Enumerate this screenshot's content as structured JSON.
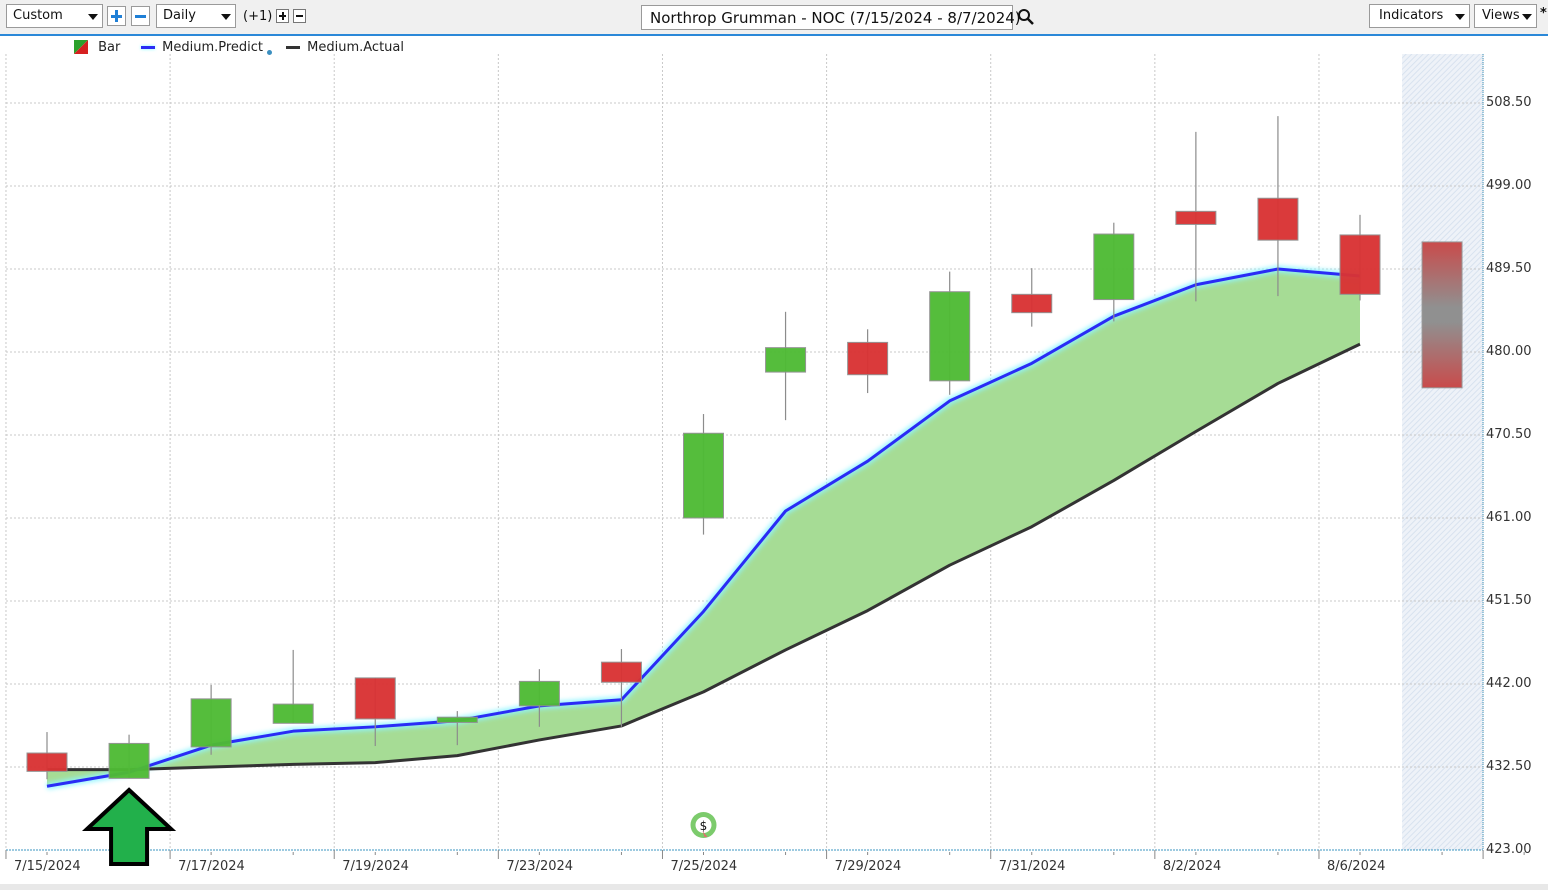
{
  "toolbar": {
    "range_select": "Custom",
    "zoom_in_label": "+",
    "zoom_out_label": "−",
    "interval_select": "Daily",
    "offset_label": "(+1)",
    "offset_plus": "+",
    "offset_minus": "−",
    "symbol_title": "Northrop Grumman - NOC (7/15/2024 - 8/7/2024)",
    "search_icon": "magnifier-icon",
    "indicators_label": "Indicators",
    "views_label": "Views",
    "modified_marker": "*"
  },
  "legend": [
    {
      "label": "Bar",
      "icon": "bar-up-down-icon"
    },
    {
      "label": "Medium.Predict",
      "icon": "blue-line-icon"
    },
    {
      "label": "Medium.Actual",
      "icon": "black-line-icon"
    }
  ],
  "colors": {
    "up": "#4fbb35",
    "down": "#d93334",
    "wick": "#8c8c8c",
    "predict": "#2a2cf5",
    "actual": "#333333",
    "band_fill": "#a6dc95",
    "forecast_shade": "#e3ebf5",
    "arrow_fill": "#22b04b"
  },
  "chart_data": {
    "type": "candlestick",
    "title": "Northrop Grumman - NOC (7/15/2024 - 8/7/2024)",
    "xlabel": "",
    "ylabel": "",
    "ylim": [
      423.0,
      508.5
    ],
    "y_ticks": [
      "423.00",
      "432.50",
      "442.00",
      "451.50",
      "461.00",
      "470.50",
      "480.00",
      "489.50",
      "499.00",
      "508.50"
    ],
    "x_tick_labels": [
      "7/15/2024",
      "7/17/2024",
      "7/19/2024",
      "7/23/2024",
      "7/25/2024",
      "7/29/2024",
      "7/31/2024",
      "8/2/2024",
      "8/6/2024"
    ],
    "grid": true,
    "legend_position": "top-left",
    "dates": [
      "7/15/2024",
      "7/16/2024",
      "7/17/2024",
      "7/18/2024",
      "7/19/2024",
      "7/22/2024",
      "7/23/2024",
      "7/24/2024",
      "7/25/2024",
      "7/26/2024",
      "7/29/2024",
      "7/30/2024",
      "7/31/2024",
      "8/1/2024",
      "8/2/2024",
      "8/5/2024",
      "8/6/2024"
    ],
    "candles": [
      {
        "open": 434.1,
        "high": 436.5,
        "low": 431.1,
        "close": 432.0
      },
      {
        "open": 431.2,
        "high": 436.2,
        "low": 431.2,
        "close": 435.2
      },
      {
        "open": 434.8,
        "high": 441.9,
        "low": 433.9,
        "close": 440.3
      },
      {
        "open": 437.5,
        "high": 445.9,
        "low": 437.5,
        "close": 439.7
      },
      {
        "open": 442.7,
        "high": 442.7,
        "low": 434.9,
        "close": 438.0
      },
      {
        "open": 437.6,
        "high": 438.9,
        "low": 435.0,
        "close": 438.2
      },
      {
        "open": 439.5,
        "high": 443.7,
        "low": 437.1,
        "close": 442.3
      },
      {
        "open": 444.5,
        "high": 446.0,
        "low": 437.1,
        "close": 442.2
      },
      {
        "open": 461.0,
        "high": 472.9,
        "low": 459.1,
        "close": 470.7
      },
      {
        "open": 477.7,
        "high": 484.6,
        "low": 472.2,
        "close": 480.5
      },
      {
        "open": 481.1,
        "high": 482.6,
        "low": 475.3,
        "close": 477.4
      },
      {
        "open": 476.7,
        "high": 489.2,
        "low": 475.1,
        "close": 486.9
      },
      {
        "open": 486.6,
        "high": 489.6,
        "low": 482.9,
        "close": 484.5
      },
      {
        "open": 486.0,
        "high": 494.8,
        "low": 483.5,
        "close": 493.5
      },
      {
        "open": 496.1,
        "high": 505.2,
        "low": 485.8,
        "close": 494.6
      },
      {
        "open": 497.6,
        "high": 507.0,
        "low": 486.4,
        "close": 492.8
      },
      {
        "open": 493.4,
        "high": 495.7,
        "low": 485.9,
        "close": 486.6
      }
    ],
    "forecast_bar": {
      "date": "8/7/2024",
      "high": 492.6,
      "low": 475.9
    },
    "series": [
      {
        "name": "Medium.Predict",
        "values": [
          430.3,
          431.9,
          435.0,
          436.6,
          437.1,
          437.8,
          439.5,
          440.2,
          450.3,
          461.8,
          467.5,
          474.4,
          478.7,
          484.1,
          487.7,
          489.5,
          488.7
        ]
      },
      {
        "name": "Medium.Actual",
        "values": [
          432.2,
          432.2,
          432.5,
          432.8,
          433.0,
          433.8,
          435.6,
          437.2,
          441.1,
          445.9,
          450.4,
          455.6,
          460.0,
          465.3,
          470.9,
          476.4,
          480.9
        ]
      }
    ],
    "annotations": [
      {
        "type": "up-arrow",
        "date": "7/16/2024"
      },
      {
        "type": "dividend-marker",
        "label": "$",
        "date": "7/25/2024"
      }
    ]
  }
}
